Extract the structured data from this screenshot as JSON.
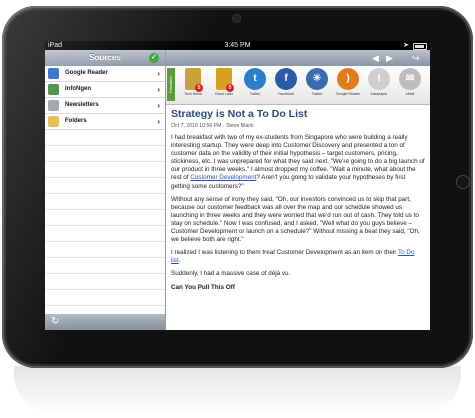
{
  "status": {
    "carrier": "iPad",
    "time": "3:45 PM"
  },
  "sidebar": {
    "title": "Sources",
    "items": [
      {
        "label": "Google Reader",
        "icon": "rss-feed-icon",
        "color": "#2b62c9"
      },
      {
        "label": "InfoNgen",
        "icon": "infongen-icon",
        "color": "#3a8a3a"
      },
      {
        "label": "Newsletters",
        "icon": "newsletters-icon",
        "color": "#9aa0a6"
      },
      {
        "label": "Folders",
        "icon": "folder-icon",
        "color": "#e0b84a"
      }
    ]
  },
  "sharebar": {
    "tab_label": "Favorites",
    "items": [
      {
        "label": "Tech News",
        "icon": "tech-news-icon",
        "color": "#c9a03a",
        "badge": "5"
      },
      {
        "label": "Read Later",
        "icon": "read-later-icon",
        "color": "#d8a020",
        "badge": "5"
      },
      {
        "label": "Twitter",
        "icon": "twitter-icon",
        "color": "#2a7fc8",
        "glyph": "t"
      },
      {
        "label": "Facebook",
        "icon": "facebook-icon",
        "color": "#2a5aa8",
        "glyph": "f"
      },
      {
        "label": "Twitter",
        "icon": "twitter-bird-icon",
        "color": "#3a6ab0",
        "glyph": "✳"
      },
      {
        "label": "Google Reader",
        "icon": "rss-icon",
        "color": "#e07a1a",
        "glyph": ")"
      },
      {
        "label": "Instapaper",
        "icon": "instapaper-icon",
        "color": "#cfcfcf",
        "glyph": "I"
      },
      {
        "label": "eMail",
        "icon": "email-icon",
        "color": "#bdbdbd",
        "glyph": "✉"
      }
    ]
  },
  "article": {
    "title": "Strategy is Not a To Do List",
    "meta": "Oct 7, 2010 10:56 PM - Steve Blank",
    "p1_a": "I had breakfast with two of my ex-students from Singapore who were building a really interesting startup. They were deep into Customer Discovery and presented a ton of customer data on the validity of their initial hypothesis – target customers, pricing, stickiness, etc.  I was unprepared for what they said next. \"We're going to do a big launch of our product in three weeks.\"  I almost dropped my coffee.  \"Wait a minute, what about the rest of ",
    "p1_link": "Customer Development",
    "p1_b": "? Aren't you going to validate your hypotheses by first getting some customers?\"",
    "p2": "Without any sense of irony they said, \"Oh, our investors convinced us to skip that part, because our customer feedback was all over the map and our schedule showed us launching in three weeks and they were worried that we'd run out of cash. They told us to stay on schedule.\"  Now I was confused, and I asked, \"Well what do you guys believe – Customer Development or launch on a schedule?\" Without missing a beat they said, \"Oh, we believe both are right.\"",
    "p3_a": "I realized I was listening to them treat Customer Development as an item on their ",
    "p3_link": "To Do list",
    "p3_b": ".",
    "p4": "Suddenly, I had a massive case of déjà vu.",
    "heading": "Can You Pull This Off"
  }
}
